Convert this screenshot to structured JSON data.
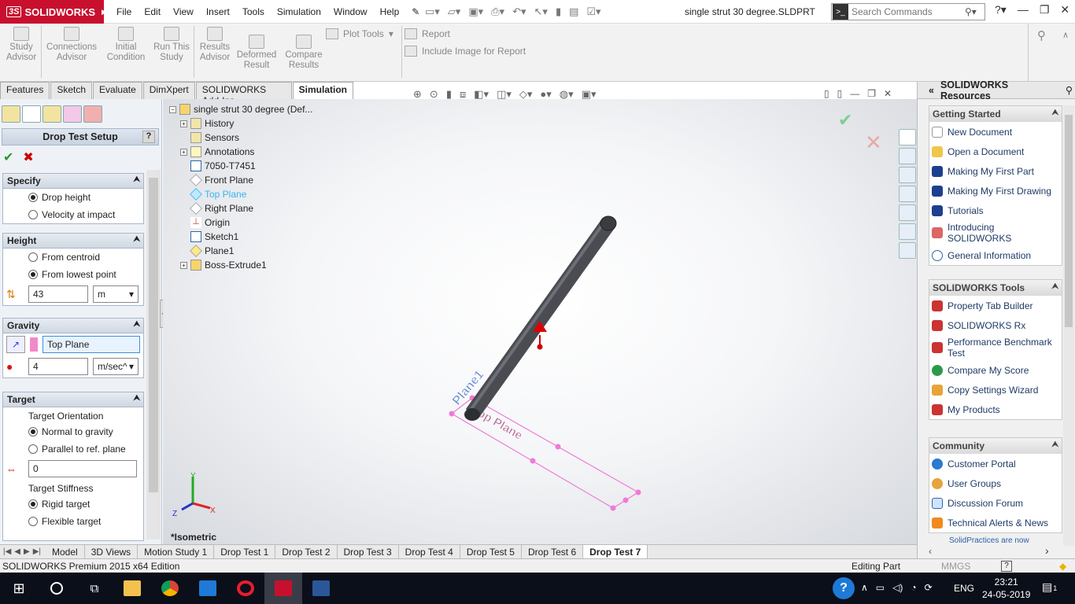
{
  "app": {
    "name": "SOLIDWORKS",
    "brand_color": "#c8102e"
  },
  "menu": [
    "File",
    "Edit",
    "View",
    "Insert",
    "Tools",
    "Simulation",
    "Window",
    "Help"
  ],
  "document_title": "single strut 30 degree.SLDPRT",
  "search": {
    "placeholder": "Search Commands"
  },
  "commands": {
    "study_advisor": "Study Advisor",
    "connections_advisor": "Connections Advisor",
    "initial_condition": "Initial Condition",
    "run_this_study": "Run This Study",
    "results_advisor": "Results Advisor",
    "deformed_result": "Deformed Result",
    "compare_results": "Compare Results",
    "plot_tools": "Plot Tools",
    "report": "Report",
    "include_image": "Include Image for Report"
  },
  "tabs": [
    "Features",
    "Sketch",
    "Evaluate",
    "DimXpert",
    "SOLIDWORKS Add-Ins",
    "Simulation"
  ],
  "active_tab": "Simulation",
  "property_manager": {
    "title": "Drop Test Setup",
    "help": "?",
    "specify": {
      "title": "Specify",
      "options": [
        "Drop height",
        "Velocity at impact"
      ],
      "selected": 0
    },
    "height": {
      "title": "Height",
      "options": [
        "From centroid",
        "From lowest point"
      ],
      "selected": 1,
      "value": "43",
      "unit": "m"
    },
    "gravity": {
      "title": "Gravity",
      "reference": "Top Plane",
      "value": "4",
      "unit": "m/sec^"
    },
    "target": {
      "title": "Target",
      "orientation_label": "Target Orientation",
      "orientation_options": [
        "Normal to gravity",
        "Parallel to ref. plane"
      ],
      "orientation_selected": 0,
      "angle_value": "0",
      "stiffness_label": "Target Stiffness",
      "stiffness_options": [
        "Rigid target",
        "Flexible target"
      ],
      "stiffness_selected": 0
    }
  },
  "feature_tree": {
    "root": "single strut 30 degree  (Def...",
    "items": [
      "History",
      "Sensors",
      "Annotations",
      "7050-T7451",
      "Front Plane",
      "Top Plane",
      "Right Plane",
      "Origin",
      "Sketch1",
      "Plane1",
      "Boss-Extrude1"
    ],
    "highlighted": "Top Plane"
  },
  "viewport": {
    "view_name": "*Isometric",
    "labels": [
      "Plane1",
      "Top Plane"
    ],
    "triad": [
      "Y",
      "Z",
      "X"
    ]
  },
  "task_pane": {
    "title": "SOLIDWORKS Resources",
    "getting_started": {
      "title": "Getting Started",
      "items": [
        "New Document",
        "Open a Document",
        "Making My First Part",
        "Making My First Drawing",
        "Tutorials",
        "Introducing SOLIDWORKS",
        "General Information"
      ]
    },
    "tools": {
      "title": "SOLIDWORKS Tools",
      "items": [
        "Property Tab Builder",
        "SOLIDWORKS Rx",
        "Performance Benchmark Test",
        "Compare My Score",
        "Copy Settings Wizard",
        "My Products"
      ]
    },
    "community": {
      "title": "Community",
      "items": [
        "Customer Portal",
        "User Groups",
        "Discussion Forum",
        "Technical Alerts & News"
      ]
    },
    "footer": "SolidPractices are now"
  },
  "bottom_tabs": [
    "Model",
    "3D Views",
    "Motion Study 1",
    "Drop Test 1",
    "Drop Test 2",
    "Drop Test 3",
    "Drop Test 4",
    "Drop Test 5",
    "Drop Test 6",
    "Drop Test 7"
  ],
  "active_bottom_tab": "Drop Test 7",
  "status": {
    "edition": "SOLIDWORKS Premium 2015 x64 Edition",
    "mode": "Editing Part",
    "units": "MMGS"
  },
  "taskbar": {
    "language": "ENG",
    "time": "23:21",
    "date": "24-05-2019",
    "notifications": "1"
  }
}
